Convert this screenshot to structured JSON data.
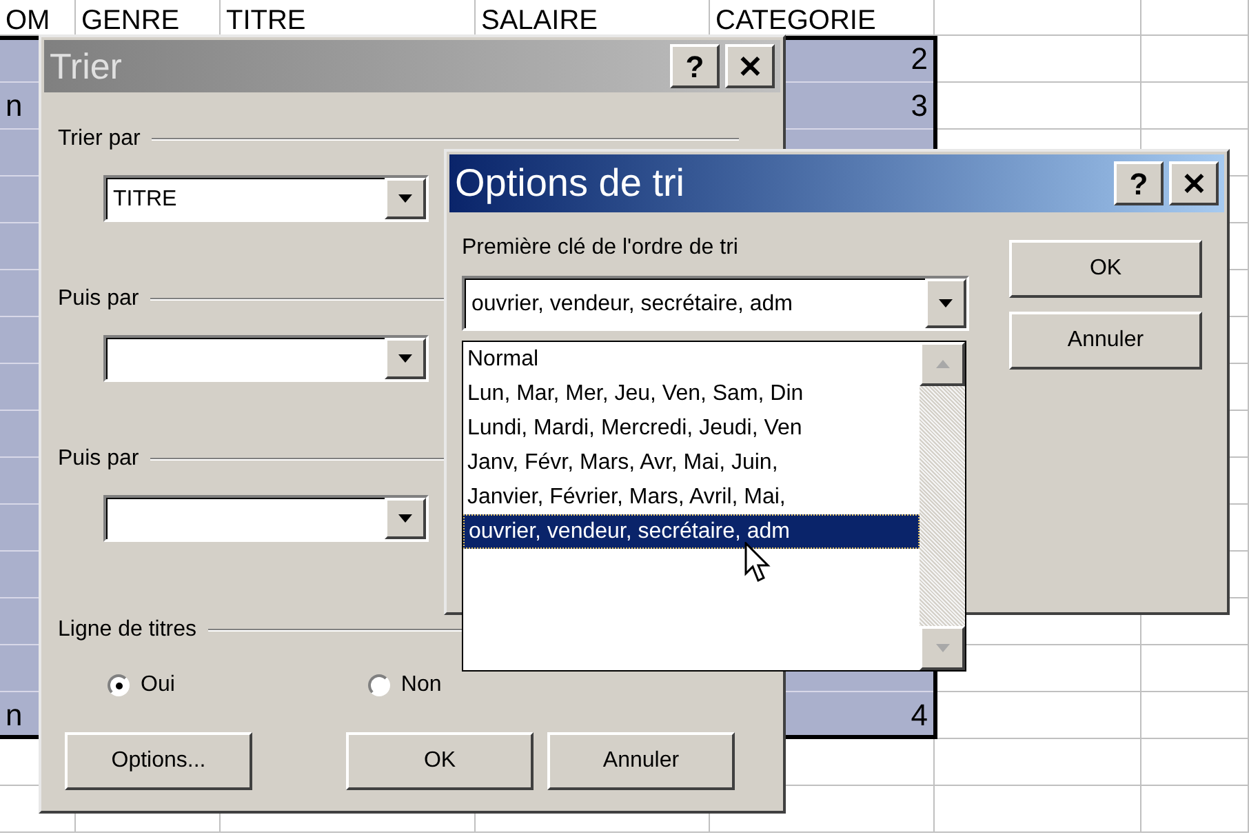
{
  "spreadsheet": {
    "columns": [
      "OM",
      "GENRE",
      "TITRE",
      "SALAIRE",
      "CATEGORIE"
    ],
    "rows": [
      {
        "selected": true,
        "categorie": "2"
      },
      {
        "selected": true,
        "first": "n",
        "categorie": "3"
      },
      {
        "selected": true
      },
      {
        "selected": true
      },
      {
        "selected": true
      },
      {
        "selected": true
      },
      {
        "selected": true
      },
      {
        "selected": true
      },
      {
        "selected": true
      },
      {
        "selected": true
      },
      {
        "selected": true
      },
      {
        "selected": true
      },
      {
        "selected": true
      },
      {
        "selected": true
      },
      {
        "selected": true,
        "first": "n",
        "categorie": "4"
      },
      {
        "selected": false
      },
      {
        "selected": false
      }
    ]
  },
  "sort_dialog": {
    "title": "Trier",
    "title_buttons": [
      "?",
      "✕"
    ],
    "keys": [
      {
        "label": "Trier par",
        "value": "TITRE"
      },
      {
        "label": "Puis par"
      },
      {
        "label": "Puis par"
      }
    ],
    "header_row": {
      "label": "Ligne de titres",
      "options": [
        {
          "label": "Oui",
          "selected": true
        },
        {
          "label": "Non",
          "selected": false
        }
      ]
    },
    "buttons": [
      "Options...",
      "OK",
      "Annuler"
    ]
  },
  "options_dialog": {
    "title": "Options de tri",
    "title_buttons": [
      "?",
      "✕"
    ],
    "first_key": {
      "label": "Première clé de l'ordre de tri",
      "value": "ouvrier, vendeur, secrétaire, adm",
      "items": [
        {
          "label": "Normal",
          "selected": false
        },
        {
          "label": "Lun, Mar, Mer, Jeu, Ven, Sam, Din",
          "selected": false
        },
        {
          "label": "Lundi, Mardi, Mercredi, Jeudi, Ven",
          "selected": false
        },
        {
          "label": "Janv, Févr, Mars, Avr, Mai, Juin,",
          "selected": false
        },
        {
          "label": "Janvier, Février, Mars, Avril, Mai,",
          "selected": false
        },
        {
          "label": "ouvrier, vendeur, secrétaire, adm",
          "selected": true
        }
      ]
    },
    "buttons": [
      "OK",
      "Annuler"
    ]
  }
}
